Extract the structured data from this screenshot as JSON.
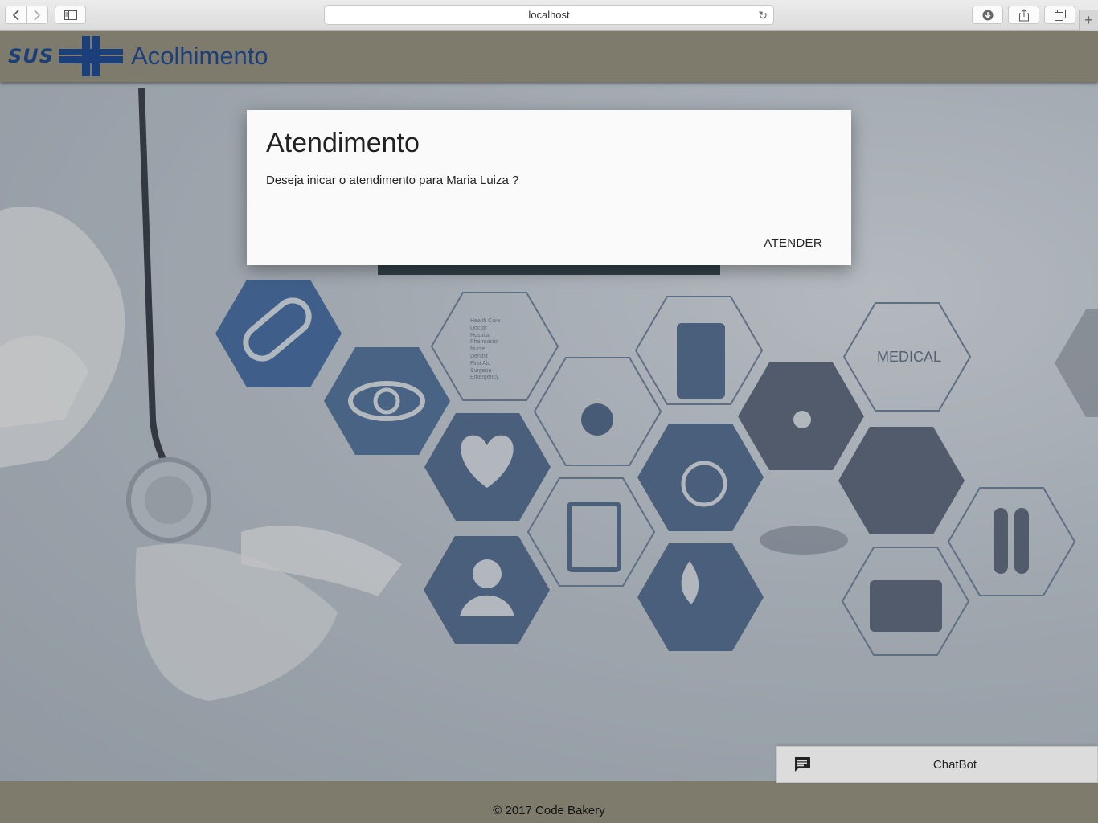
{
  "browser": {
    "address": "localhost"
  },
  "header": {
    "logo_sus": "SUS",
    "logo_title": "Acolhimento"
  },
  "background": {
    "hex_labels": [
      "Health Care",
      "Doctor",
      "Hospital",
      "Pharmacist",
      "Nurse",
      "Dentist",
      "First Aid",
      "Surgeon",
      "Emergency"
    ],
    "medical_label": "MEDICAL"
  },
  "dialog": {
    "title": "Atendimento",
    "message": "Deseja inicar o atendimento para Maria Luiza ?",
    "action_label": "ATENDER"
  },
  "chatbot": {
    "label": "ChatBot",
    "icon": "chat-icon"
  },
  "footer": {
    "text": "© 2017 Code Bakery"
  },
  "colors": {
    "header_bg": "#7e7b6d",
    "brand_blue": "#1b3f7a",
    "dialog_bg": "#fafafa"
  }
}
